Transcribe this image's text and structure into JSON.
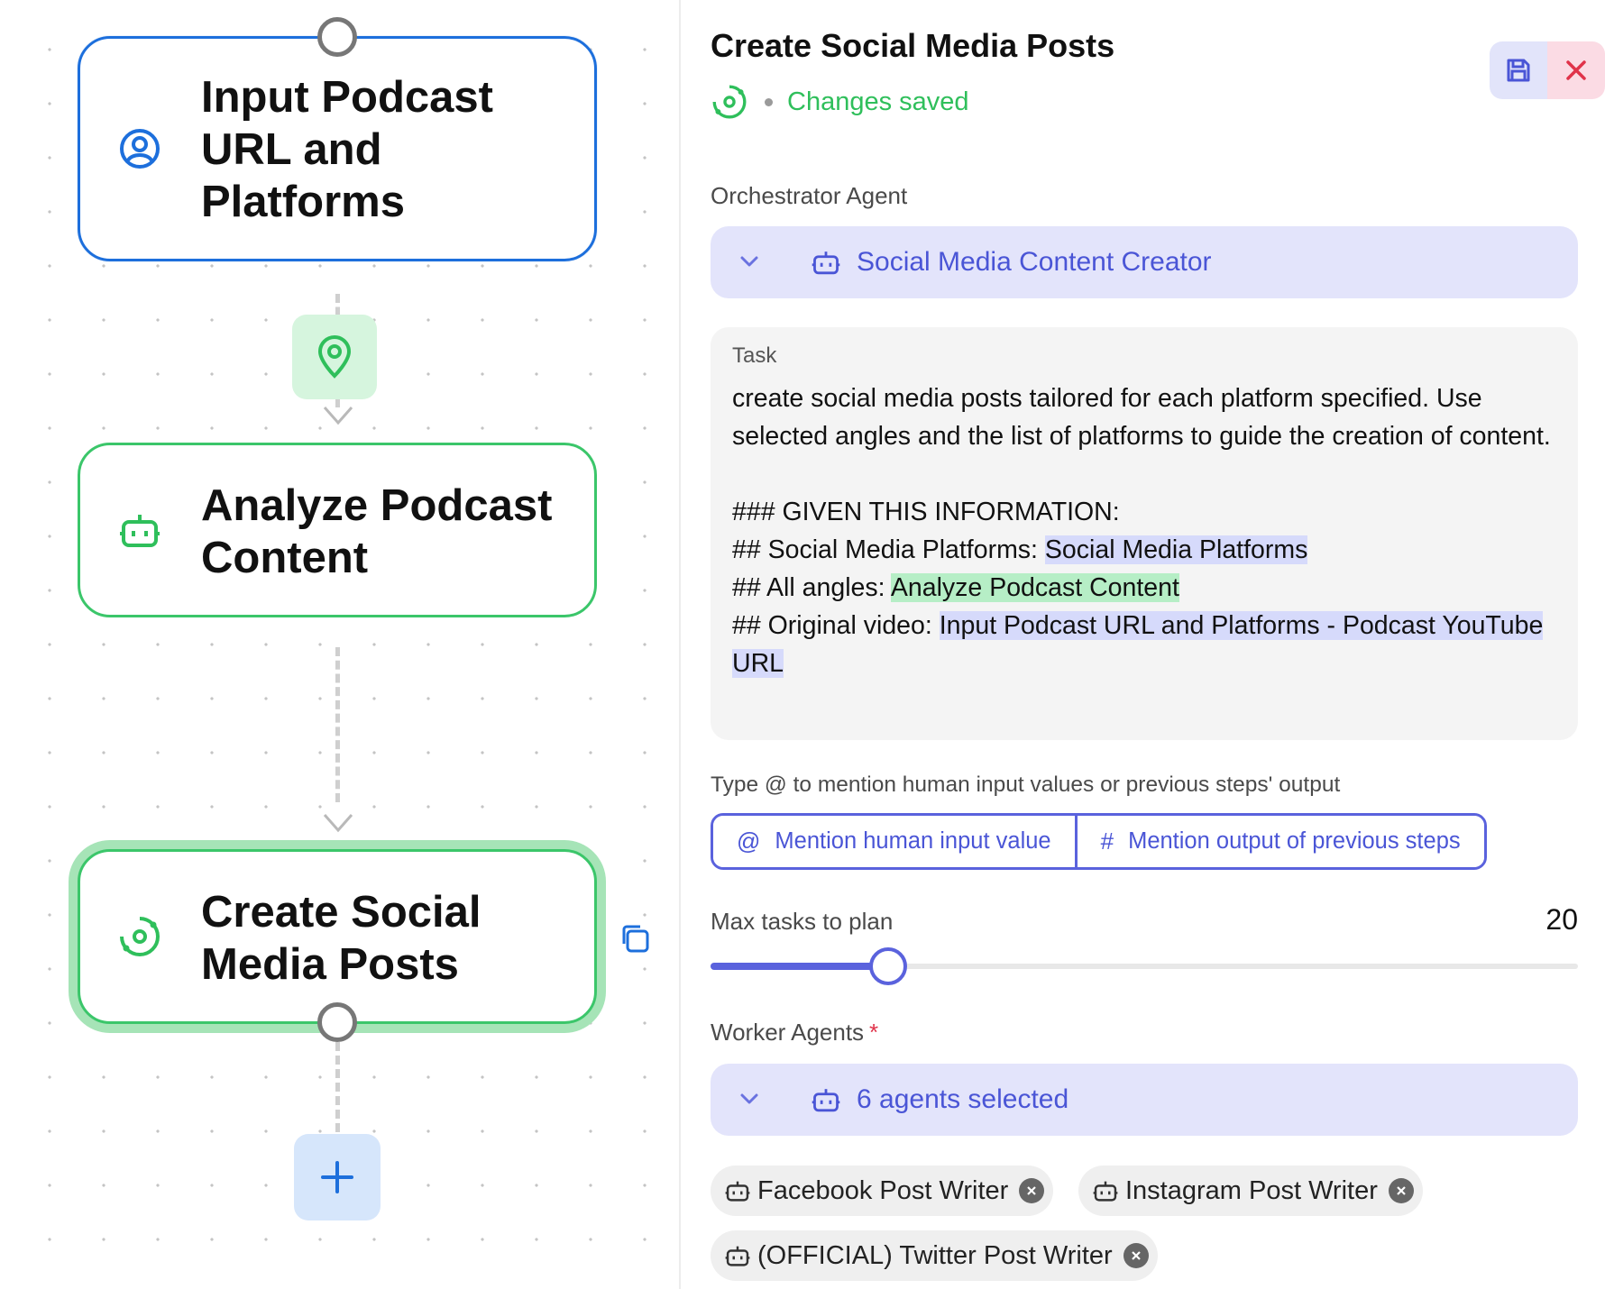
{
  "canvas": {
    "nodes": [
      {
        "title": "Input Podcast URL and Platforms",
        "icon": "user-circle-icon",
        "color": "#1d6fdc"
      },
      {
        "title": "Analyze Podcast Content",
        "icon": "robot-icon",
        "color": "#3bc66a"
      },
      {
        "title": "Create Social Media Posts",
        "icon": "orchestrator-icon",
        "color": "#3bc66a"
      }
    ],
    "add_label": "+"
  },
  "panel": {
    "title": "Create Social Media Posts",
    "status": "Changes saved",
    "orchestrator": {
      "label": "Orchestrator Agent",
      "value": "Social Media Content Creator"
    },
    "task": {
      "label": "Task",
      "line1": "create social media posts tailored for each platform specified. Use selected angles and the list of platforms to guide the creation of content.",
      "header": "### GIVEN THIS INFORMATION:",
      "platforms_prefix": "## Social Media Platforms: ",
      "platforms_mention": "Social Media Platforms",
      "angles_prefix": "## All angles: ",
      "angles_mention": "Analyze Podcast Content",
      "video_prefix": "## Original video: ",
      "video_mention": "Input Podcast URL and Platforms - Podcast YouTube URL"
    },
    "mention_hint": "Type @ to mention human input values or previous steps' output",
    "mention_human": {
      "symbol": "@",
      "label": "Mention human input value"
    },
    "mention_output": {
      "symbol": "#",
      "label": "Mention output of previous steps"
    },
    "max_tasks": {
      "label": "Max tasks to plan",
      "value": "20",
      "fraction": 0.205
    },
    "workers": {
      "label": "Worker Agents",
      "required": "*",
      "value": "6 agents selected",
      "chips": [
        "Facebook Post Writer",
        "Instagram Post Writer",
        "(OFFICIAL) Twitter Post Writer"
      ]
    },
    "colors": {
      "accent": "#5a62dd",
      "success": "#2fbf5b",
      "danger": "#e0334a"
    }
  }
}
